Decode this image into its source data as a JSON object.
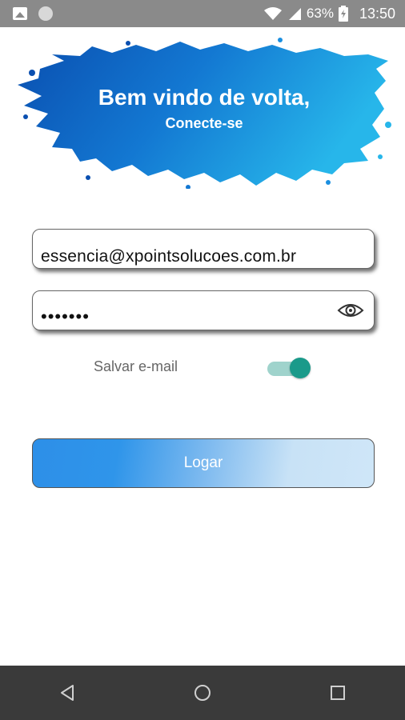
{
  "status_bar": {
    "battery": "63%",
    "time": "13:50",
    "icons": [
      "gallery-icon",
      "circle-icon",
      "wifi-icon",
      "signal-icon",
      "battery-icon"
    ]
  },
  "header": {
    "title": "Bem vindo de volta,",
    "subtitle": "Conecte-se"
  },
  "form": {
    "email_value": "essencia@xpointsolucoes.com.br",
    "password_mask": "•••••••",
    "save_email_label": "Salvar e-mail",
    "save_email_on": true,
    "login_label": "Logar"
  },
  "nav": {
    "buttons": [
      "back-icon",
      "home-icon",
      "recents-icon"
    ]
  },
  "colors": {
    "accent_blue": "#2d8fe8",
    "toggle_teal": "#1a9a8a",
    "status_bar": "#8a8a8a",
    "nav_bar": "#3a3a3a"
  }
}
